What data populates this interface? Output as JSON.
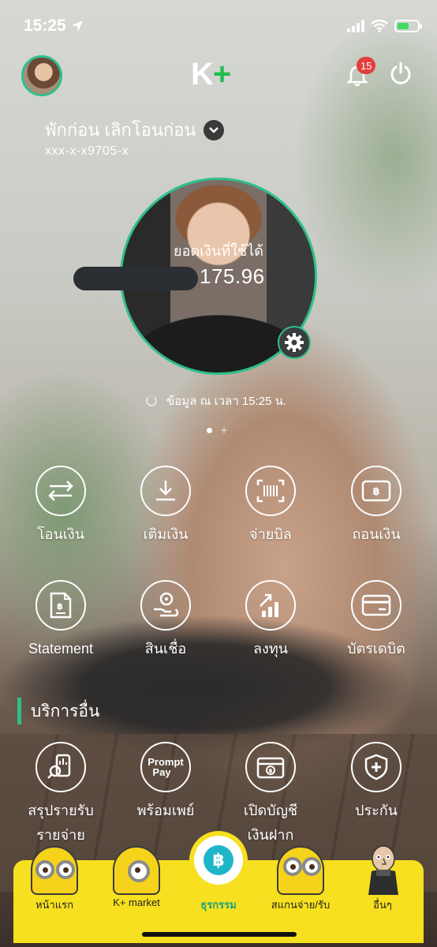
{
  "status_bar": {
    "time": "15:25"
  },
  "header": {
    "logo_k": "K",
    "logo_plus": "+",
    "notification_count": "15"
  },
  "account": {
    "name": "พักก่อน เลิกโอนก่อน",
    "number": "xxx-x-x9705-x"
  },
  "balance": {
    "label": "ยอดเงินที่ใช้ได้",
    "value": "175.96",
    "updated": "ข้อมูล ณ เวลา 15:25 น."
  },
  "quick_menu": [
    {
      "label": "โอนเงิน",
      "icon": "transfer-icon"
    },
    {
      "label": "เติมเงิน",
      "icon": "topup-icon"
    },
    {
      "label": "จ่ายบิล",
      "icon": "barcode-icon"
    },
    {
      "label": "ถอนเงิน",
      "icon": "withdraw-icon"
    },
    {
      "label": "Statement",
      "icon": "statement-icon"
    },
    {
      "label": "สินเชื่อ",
      "icon": "loan-icon"
    },
    {
      "label": "ลงทุน",
      "icon": "invest-icon"
    },
    {
      "label": "บัตรเดบิต",
      "icon": "debit-card-icon"
    }
  ],
  "other_services": {
    "title": "บริการอื่น",
    "items": [
      {
        "label_line1": "สรุปรายรับ",
        "label_line2": "รายจ่าย",
        "icon": "summary-icon"
      },
      {
        "label_line1": "พร้อมเพย์",
        "label_line2": "",
        "icon": "promptpay-icon",
        "icon_text_1": "Prompt",
        "icon_text_2": "Pay"
      },
      {
        "label_line1": "เปิดบัญชี",
        "label_line2": "เงินฝาก",
        "icon": "open-account-icon"
      },
      {
        "label_line1": "ประกัน",
        "label_line2": "",
        "icon": "insurance-icon"
      }
    ]
  },
  "bottom_nav": [
    {
      "label": "หน้าแรก",
      "icon": "minion-home-icon",
      "active": false
    },
    {
      "label": "K+ market",
      "icon": "minion-market-icon",
      "active": false
    },
    {
      "label": "ธุรกรรม",
      "icon": "baht-coin-icon",
      "active": true
    },
    {
      "label": "สแกนจ่าย/รับ",
      "icon": "minion-scan-icon",
      "active": false
    },
    {
      "label": "อื่นๆ",
      "icon": "gru-more-icon",
      "active": false
    }
  ],
  "colors": {
    "accent_green": "#2fbf8a",
    "logo_green": "#1fbf4f",
    "nav_yellow": "#f7e01f",
    "badge_red": "#e43d3d",
    "coin_blue": "#1fb5c9"
  }
}
